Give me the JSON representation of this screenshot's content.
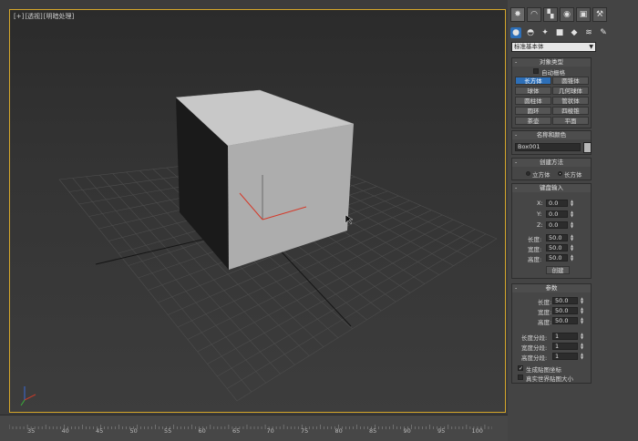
{
  "viewport": {
    "labels": [
      "[+]",
      "[透视]",
      "[明暗处理]"
    ]
  },
  "timeline": {
    "ticks": [
      "35",
      "40",
      "45",
      "50",
      "55",
      "60",
      "65",
      "70",
      "75",
      "80",
      "85",
      "90",
      "95",
      "100"
    ]
  },
  "panel": {
    "tabs": [
      "create-icon",
      "modify-icon",
      "hierarchy-icon",
      "motion-icon",
      "display-icon",
      "utilities-icon"
    ],
    "subtabs": [
      "geometry-icon",
      "shapes-icon",
      "lights-icon",
      "cameras-icon",
      "helpers-icon",
      "spacewarps-icon",
      "systems-icon"
    ],
    "category": "标准基本体",
    "object_type": {
      "title": "对象类型",
      "autogrid": "自动栅格",
      "buttons": [
        "长方体",
        "圆锥体",
        "球体",
        "几何球体",
        "圆柱体",
        "管状体",
        "圆环",
        "四棱锥",
        "茶壶",
        "平面"
      ]
    },
    "name_color": {
      "title": "名称和颜色",
      "name": "Box001"
    },
    "creation_method": {
      "title": "创建方法",
      "options": [
        "立方体",
        "长方体"
      ]
    },
    "keyboard_entry": {
      "title": "键盘输入",
      "fields": [
        {
          "label": "X:",
          "value": "0.0"
        },
        {
          "label": "Y:",
          "value": "0.0"
        },
        {
          "label": "Z:",
          "value": "0.0"
        },
        {
          "label": "长度:",
          "value": "50.0"
        },
        {
          "label": "宽度:",
          "value": "50.0"
        },
        {
          "label": "高度:",
          "value": "50.0"
        }
      ],
      "create_button": "创建"
    },
    "parameters": {
      "title": "参数",
      "fields": [
        {
          "label": "长度:",
          "value": "50.0"
        },
        {
          "label": "宽度:",
          "value": "50.0"
        },
        {
          "label": "高度:",
          "value": "50.0"
        },
        {
          "label": "长度分段:",
          "value": "1"
        },
        {
          "label": "宽度分段:",
          "value": "1"
        },
        {
          "label": "高度分段:",
          "value": "1"
        }
      ],
      "gen_map": "生成贴图坐标",
      "real_world": "真实世界贴图大小"
    }
  }
}
